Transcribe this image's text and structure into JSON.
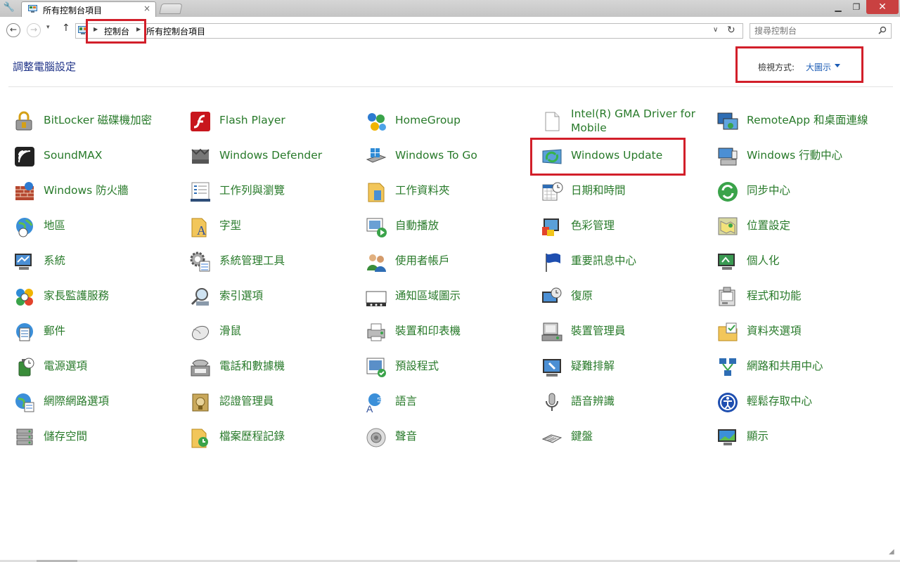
{
  "tab": {
    "title": "所有控制台項目",
    "close_label": "×"
  },
  "window": {
    "minimize": "▁",
    "maximize": "❐",
    "close": "✕"
  },
  "nav": {
    "back": "←",
    "forward": "→",
    "dropdown": "▾",
    "up": "↑"
  },
  "address": {
    "crumbs": [
      "控制台",
      "所有控制台項目"
    ],
    "dropdown": "∨",
    "refresh": "↻"
  },
  "search": {
    "placeholder": "搜尋控制台"
  },
  "header": {
    "title": "調整電腦設定",
    "view_label": "檢視方式:",
    "view_value": "大圖示"
  },
  "accent_colors": {
    "link_green": "#287a2a",
    "title_blue": "#1e3287",
    "highlight_red": "#d21f2a"
  },
  "items": [
    {
      "label": "BitLocker 磁碟機加密",
      "icon": "bitlocker-icon"
    },
    {
      "label": "Flash Player",
      "icon": "flash-player-icon"
    },
    {
      "label": "HomeGroup",
      "icon": "homegroup-icon"
    },
    {
      "label": "Intel(R) GMA Driver for Mobile",
      "icon": "intel-driver-icon"
    },
    {
      "label": "RemoteApp 和桌面連線",
      "icon": "remoteapp-icon"
    },
    {
      "label": "SoundMAX",
      "icon": "soundmax-icon"
    },
    {
      "label": "Windows Defender",
      "icon": "defender-icon"
    },
    {
      "label": "Windows To Go",
      "icon": "windows-to-go-icon"
    },
    {
      "label": "Windows Update",
      "icon": "windows-update-icon"
    },
    {
      "label": "Windows 行動中心",
      "icon": "mobility-center-icon"
    },
    {
      "label": "Windows 防火牆",
      "icon": "firewall-icon"
    },
    {
      "label": "工作列與瀏覽",
      "icon": "taskbar-icon"
    },
    {
      "label": "工作資料夾",
      "icon": "work-folders-icon"
    },
    {
      "label": "日期和時間",
      "icon": "date-time-icon"
    },
    {
      "label": "同步中心",
      "icon": "sync-center-icon"
    },
    {
      "label": "地區",
      "icon": "region-icon"
    },
    {
      "label": "字型",
      "icon": "fonts-icon"
    },
    {
      "label": "自動播放",
      "icon": "autoplay-icon"
    },
    {
      "label": "色彩管理",
      "icon": "color-management-icon"
    },
    {
      "label": "位置設定",
      "icon": "location-icon"
    },
    {
      "label": "系統",
      "icon": "system-icon"
    },
    {
      "label": "系統管理工具",
      "icon": "admin-tools-icon"
    },
    {
      "label": "使用者帳戶",
      "icon": "user-accounts-icon"
    },
    {
      "label": "重要訊息中心",
      "icon": "action-center-icon"
    },
    {
      "label": "個人化",
      "icon": "personalization-icon"
    },
    {
      "label": "家長監護服務",
      "icon": "family-safety-icon"
    },
    {
      "label": "索引選項",
      "icon": "indexing-icon"
    },
    {
      "label": "通知區域圖示",
      "icon": "notification-area-icon"
    },
    {
      "label": "復原",
      "icon": "recovery-icon"
    },
    {
      "label": "程式和功能",
      "icon": "programs-features-icon"
    },
    {
      "label": "郵件",
      "icon": "mail-icon"
    },
    {
      "label": "滑鼠",
      "icon": "mouse-icon"
    },
    {
      "label": "裝置和印表機",
      "icon": "devices-printers-icon"
    },
    {
      "label": "裝置管理員",
      "icon": "device-manager-icon"
    },
    {
      "label": "資料夾選項",
      "icon": "folder-options-icon"
    },
    {
      "label": "電源選項",
      "icon": "power-options-icon"
    },
    {
      "label": "電話和數據機",
      "icon": "phone-modem-icon"
    },
    {
      "label": "預設程式",
      "icon": "default-programs-icon"
    },
    {
      "label": "疑難排解",
      "icon": "troubleshooting-icon"
    },
    {
      "label": "網路和共用中心",
      "icon": "network-sharing-icon"
    },
    {
      "label": "網際網路選項",
      "icon": "internet-options-icon"
    },
    {
      "label": "認證管理員",
      "icon": "credential-manager-icon"
    },
    {
      "label": "語言",
      "icon": "language-icon"
    },
    {
      "label": "語音辨識",
      "icon": "speech-recognition-icon"
    },
    {
      "label": "輕鬆存取中心",
      "icon": "ease-of-access-icon"
    },
    {
      "label": "儲存空間",
      "icon": "storage-spaces-icon"
    },
    {
      "label": "檔案歷程記錄",
      "icon": "file-history-icon"
    },
    {
      "label": "聲音",
      "icon": "sound-icon"
    },
    {
      "label": "鍵盤",
      "icon": "keyboard-icon"
    },
    {
      "label": "顯示",
      "icon": "display-icon"
    }
  ]
}
